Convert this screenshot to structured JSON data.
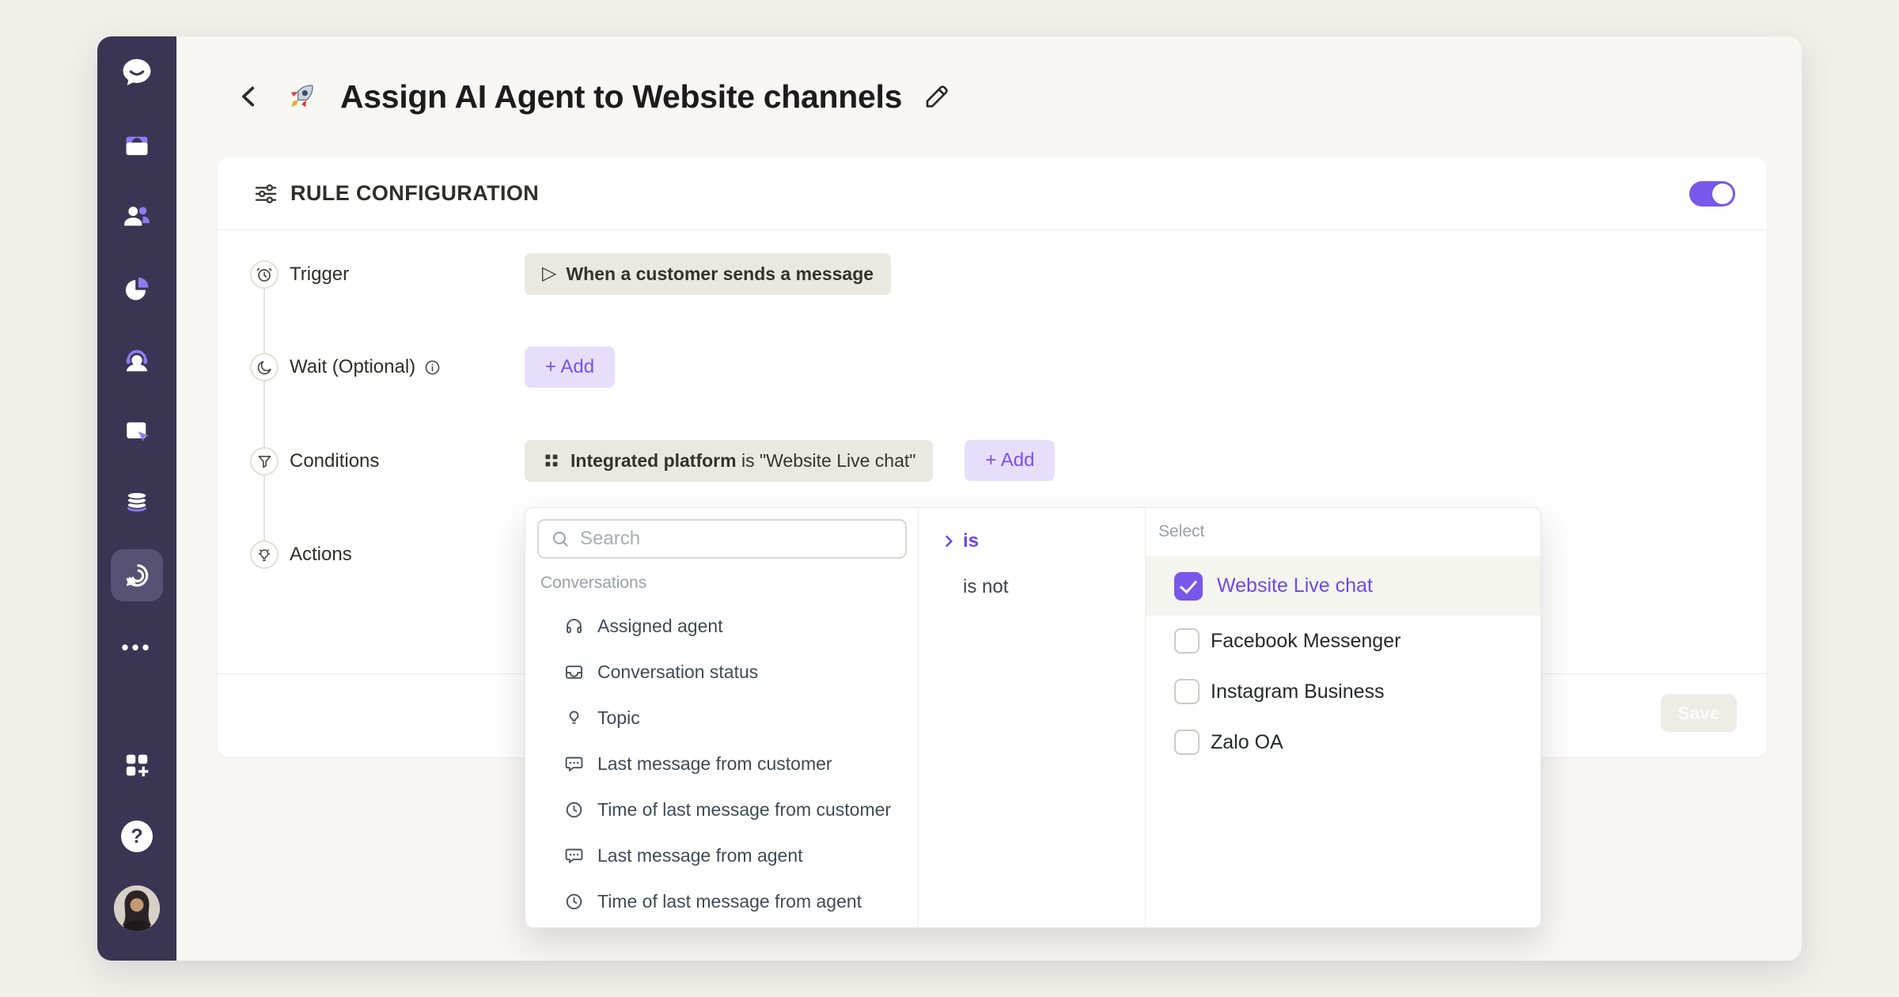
{
  "colors": {
    "page_bg": "#f2efe9",
    "content_bg": "#f8f7f3",
    "sidebar_bg": "#3b3554",
    "sidebar_active_bg": "#575174",
    "accent_purple": "#7857eb",
    "purple_text": "#6d48ee",
    "add_button_bg": "#e7defc",
    "chip_bg": "#eae9e1",
    "card_bg": "#ffffff"
  },
  "glyphs": {
    "play": "▷",
    "ellipsis": "•••",
    "help": "?"
  },
  "sidebar": {
    "icons": [
      "chat-logo",
      "inbox",
      "contacts",
      "reports",
      "agents",
      "website-channel",
      "database",
      "automation",
      "more",
      "apps",
      "help",
      "avatar"
    ],
    "active_icon": "automation"
  },
  "header": {
    "title": "Assign AI Agent to Website channels"
  },
  "card": {
    "title": "RULE CONFIGURATION",
    "toggle_on": true,
    "steps": {
      "trigger": {
        "label": "Trigger",
        "chip": "When a customer sends a message"
      },
      "wait": {
        "label": "Wait (Optional)",
        "add_label": "+ Add"
      },
      "conditions": {
        "label": "Conditions",
        "chip_field": "Integrated platform",
        "chip_rest": " is \"Website Live chat\"",
        "add_label": "+ Add"
      },
      "actions": {
        "label": "Actions"
      }
    },
    "save_label": "Save"
  },
  "dropdown": {
    "search_placeholder": "Search",
    "group_label": "Conversations",
    "items": [
      {
        "icon": "headphones-icon",
        "label": "Assigned agent"
      },
      {
        "icon": "inbox-icon",
        "label": "Conversation status"
      },
      {
        "icon": "lightbulb-icon",
        "label": "Topic"
      },
      {
        "icon": "message-icon",
        "label": "Last message from customer"
      },
      {
        "icon": "clock-icon",
        "label": "Time of last message from customer"
      },
      {
        "icon": "message-icon",
        "label": "Last message from agent"
      },
      {
        "icon": "clock-icon",
        "label": "Time of last message from agent"
      }
    ],
    "operators": [
      {
        "label": "is",
        "selected": true
      },
      {
        "label": "is not",
        "selected": false
      }
    ],
    "select_label": "Select",
    "options": [
      {
        "label": "Website Live chat",
        "checked": true
      },
      {
        "label": "Facebook Messenger",
        "checked": false
      },
      {
        "label": "Instagram Business",
        "checked": false
      },
      {
        "label": "Zalo OA",
        "checked": false
      }
    ]
  }
}
